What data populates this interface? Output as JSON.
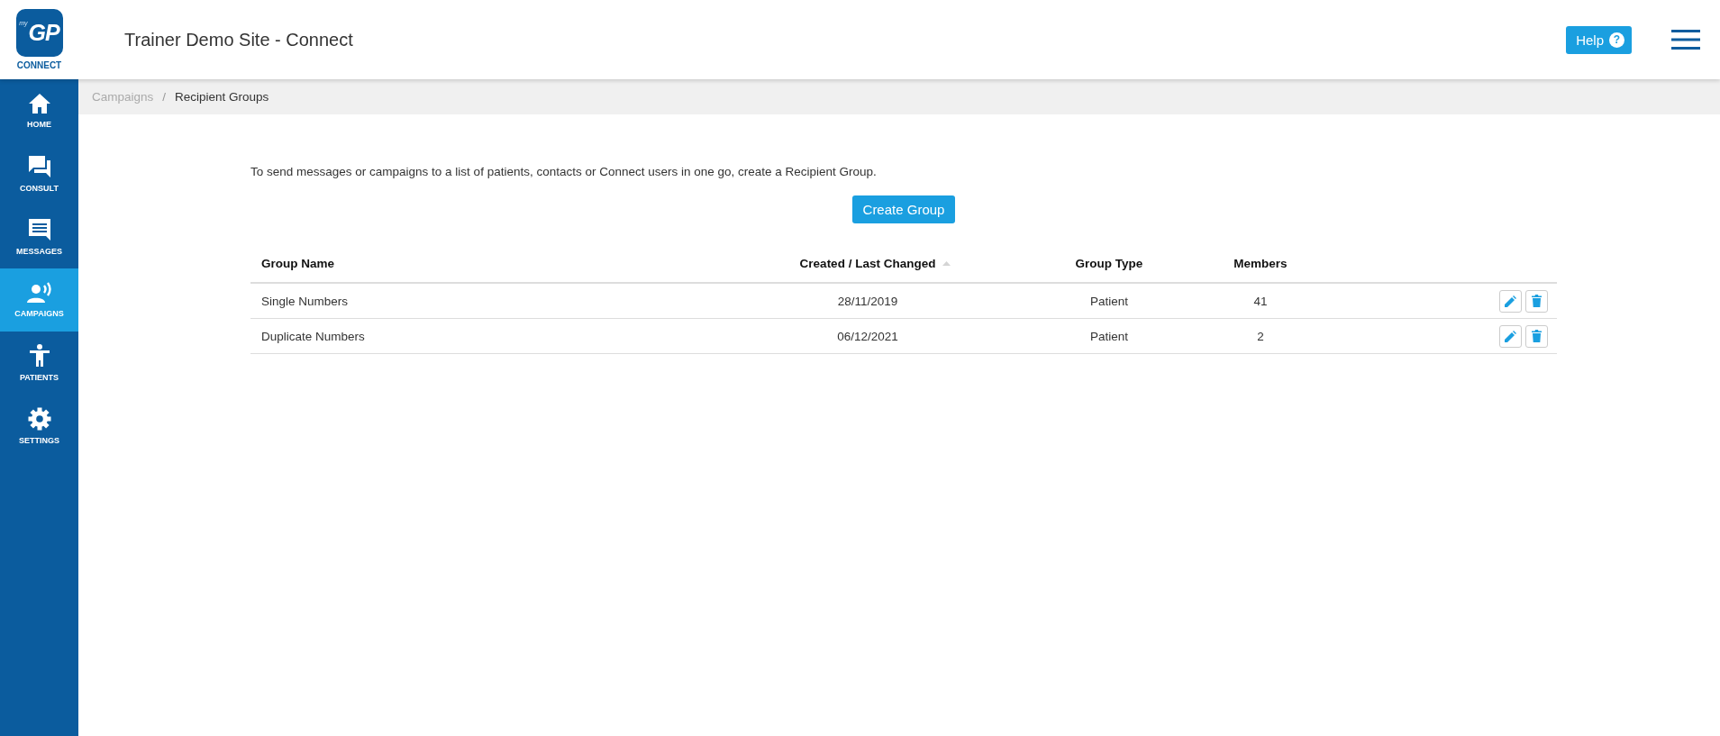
{
  "logo": {
    "superscript": "my",
    "mark": "GP",
    "caption": "CONNECT"
  },
  "header": {
    "title": "Trainer Demo Site - Connect",
    "help_button": "Help",
    "help_icon": "?"
  },
  "sidebar": {
    "items": [
      {
        "label": "HOME",
        "selected": false
      },
      {
        "label": "CONSULT",
        "selected": false
      },
      {
        "label": "MESSAGES",
        "selected": false
      },
      {
        "label": "CAMPAIGNS",
        "selected": true
      },
      {
        "label": "PATIENTS",
        "selected": false
      },
      {
        "label": "SETTINGS",
        "selected": false
      }
    ]
  },
  "breadcrumb": {
    "separator": "/",
    "items": [
      {
        "label": "Campaigns",
        "current": false
      },
      {
        "label": "Recipient Groups",
        "current": true
      }
    ]
  },
  "intro": "To send messages or campaigns to a list of patients, contacts or Connect users in one go, create a Recipient Group.",
  "create_button": "Create Group",
  "table": {
    "columns": [
      {
        "label": "Group Name",
        "sorted": false
      },
      {
        "label": "Created / Last Changed",
        "sorted": true
      },
      {
        "label": "Group Type",
        "sorted": false
      },
      {
        "label": "Members",
        "sorted": false
      }
    ],
    "rows": [
      {
        "cells": [
          "Single Numbers",
          "28/11/2019",
          "Patient",
          "41"
        ]
      },
      {
        "cells": [
          "Duplicate Numbers",
          "06/12/2021",
          "Patient",
          "2"
        ]
      }
    ]
  }
}
